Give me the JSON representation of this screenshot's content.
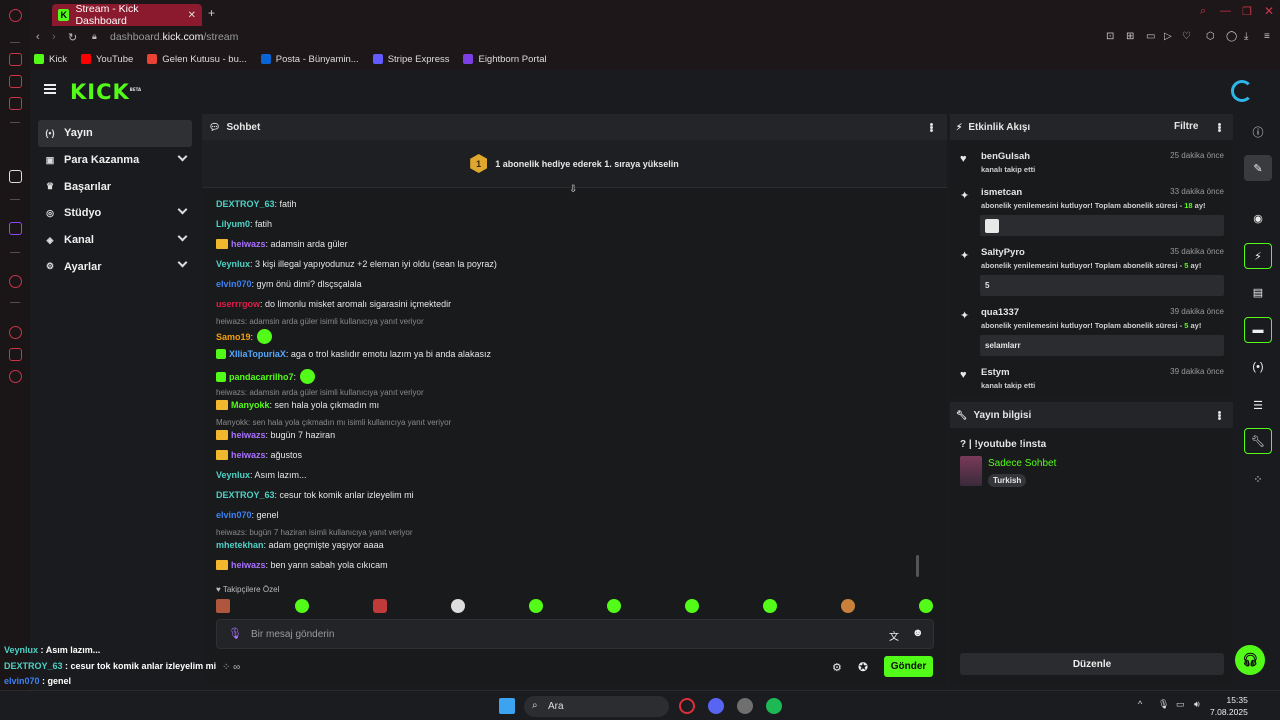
{
  "browser": {
    "tab_title": "Stream - Kick Dashboard",
    "url_domain": "dashboard.kick.com",
    "url_path": "/stream",
    "url_prefix": "dashboard.",
    "url_host": "kick.com",
    "bookmarks": [
      {
        "label": "Kick",
        "color": "#53fc18"
      },
      {
        "label": "YouTube",
        "color": "#ff0000"
      },
      {
        "label": "Gelen Kutusu - bu...",
        "color": "#ea4335"
      },
      {
        "label": "Posta - Bünyamin...",
        "color": "#0a64d6"
      },
      {
        "label": "Stripe Express",
        "color": "#635bff"
      },
      {
        "label": "Eightborn Portal",
        "color": "#7b3fe4"
      }
    ]
  },
  "app": {
    "logo": "KICK",
    "logo_badge": "BETA",
    "nav": [
      {
        "label": "Yayın",
        "icon": "(•)",
        "active": true,
        "chevron": false
      },
      {
        "label": "Para Kazanma",
        "icon": "▣",
        "chevron": true
      },
      {
        "label": "Başarılar",
        "icon": "🏆",
        "chevron": false
      },
      {
        "label": "Stüdyo",
        "icon": "◎",
        "chevron": true
      },
      {
        "label": "Kanal",
        "icon": "◈",
        "chevron": true
      },
      {
        "label": "Ayarlar",
        "icon": "⚙",
        "chevron": true
      }
    ]
  },
  "chat": {
    "title": "Sohbet",
    "pinned_rank": "1",
    "pinned_text": "1 abonelik hediye ederek 1. sıraya yükselin",
    "messages": [
      {
        "user": "DEXTROY_63",
        "color": "#4fd1c5",
        "text": ": fatih"
      },
      {
        "user": "Lilyum0",
        "color": "#4fd1c5",
        "text": ": fatih"
      },
      {
        "user": "heiwazs",
        "color": "#a970ff",
        "text": ": adamsin arda güler",
        "crown": true
      },
      {
        "user": "Veynlux",
        "color": "#4fd1c5",
        "text": ": 3 kişi illegal yapıyodunuz +2 eleman iyi oldu (sean la poyraz)"
      },
      {
        "user": "elvin070",
        "color": "#3b82f6",
        "text": ": gym önü dimi? dlsçsçalala"
      },
      {
        "user": "userrrgow",
        "color": "#e11d48",
        "text": ": do limonlu misket aromalı sigarasini içmektedir"
      },
      {
        "reply": "heiwazs: adamsin arda güler isimli kullanıcıya yanıt veriyor"
      },
      {
        "user": "Samo19",
        "color": "#f59e0b",
        "text": ":",
        "emote": true
      },
      {
        "user": "XIliaTopuriaX",
        "color": "#53a8fc",
        "text": ": aga o trol kaslıdır emotu lazım ya bi anda alakasız",
        "badge": "#53fc18"
      },
      {
        "user": "pandacarrilho7",
        "color": "#53fc18",
        "text": ":",
        "badge": "#53fc18",
        "emote": true
      },
      {
        "reply": "heiwazs: adamsin arda güler isimli kullanıcıya yanıt veriyor"
      },
      {
        "user": "Manyokk",
        "color": "#53fc18",
        "text": ": sen hala yola çıkmadın mı",
        "crown": true
      },
      {
        "reply": "Manyokk: sen hala yola çıkmadın mı isimli kullanıcıya yanıt veriyor"
      },
      {
        "user": "heiwazs",
        "color": "#a970ff",
        "text": ": bugün 7 haziran",
        "crown": true
      },
      {
        "user": "heiwazs",
        "color": "#a970ff",
        "text": ": ağustos",
        "crown": true
      },
      {
        "user": "Veynlux",
        "color": "#4fd1c5",
        "text": ": Asım lazım..."
      },
      {
        "user": "DEXTROY_63",
        "color": "#4fd1c5",
        "text": ": cesur tok komik anlar izleyelim mi"
      },
      {
        "user": "elvin070",
        "color": "#3b82f6",
        "text": ": genel"
      },
      {
        "reply": "heiwazs: bugün 7 haziran isimli kullanıcıya yanıt veriyor"
      },
      {
        "user": "mhetekhan",
        "color": "#4fd1c5",
        "text": ": adam geçmişte yaşıyor aaaa"
      },
      {
        "user": "heiwazs",
        "color": "#a970ff",
        "text": ": ben yarın sabah yola cıkıcam",
        "crown": true
      }
    ],
    "emote_row_label": "Takipçilere Özel",
    "input_placeholder": "Bir mesaj gönderin",
    "send_label": "Gönder"
  },
  "activity": {
    "title": "Etkinlik Akışı",
    "filter_label": "Filtre",
    "items": [
      {
        "name": "benGulsah",
        "time": "25 dakika önce",
        "sub": "kanalı takip etti",
        "icon": "♥"
      },
      {
        "name": "ismetcan",
        "time": "33 dakika önce",
        "sub_pre": "abonelik yenilemesini kutluyor! Toplam abonelik süresi - ",
        "months": "18",
        "sub_post": " ay!",
        "box": "",
        "icon": "✦"
      },
      {
        "name": "SaltyPyro",
        "time": "35 dakika önce",
        "sub_pre": "abonelik yenilemesini kutluyor! Toplam abonelik süresi - ",
        "months": "5",
        "sub_post": " ay!",
        "box": "5",
        "icon": "✦"
      },
      {
        "name": "qua1337",
        "time": "39 dakika önce",
        "sub_pre": "abonelik yenilemesini kutluyor! Toplam abonelik süresi - ",
        "months": "5",
        "sub_post": " ay!",
        "box": "selamlarr",
        "icon": "✦"
      },
      {
        "name": "Estym",
        "time": "39 dakika önce",
        "sub": "kanalı takip etti",
        "icon": "♥"
      }
    ]
  },
  "stream_info": {
    "title": "Yayın bilgisi",
    "stream_title": "? | !youtube !insta",
    "category": "Sadece Sohbet",
    "language_tag": "Turkish",
    "edit_label": "Düzenle"
  },
  "overlay": [
    {
      "user": "Veynlux",
      "color": "#4fd1c5",
      "text": " : Asım lazım..."
    },
    {
      "user": "DEXTROY_63",
      "color": "#4fd1c5",
      "text": " : cesur tok komik anlar izleyelim mi"
    },
    {
      "user": "elvin070",
      "color": "#3b82f6",
      "text": " : genel"
    },
    {
      "user": "mhetekhan",
      "color": "#53fc18",
      "text": " : adam geçmişte yaşıyor aaaa"
    },
    {
      "user": "heiwazs",
      "color": "#a970ff",
      "text": " : ben yarın sabah yola cıkıcam",
      "crown": true
    }
  ],
  "taskbar": {
    "search_label": "Ara",
    "time": "15:35",
    "date": "7.08.2025"
  }
}
